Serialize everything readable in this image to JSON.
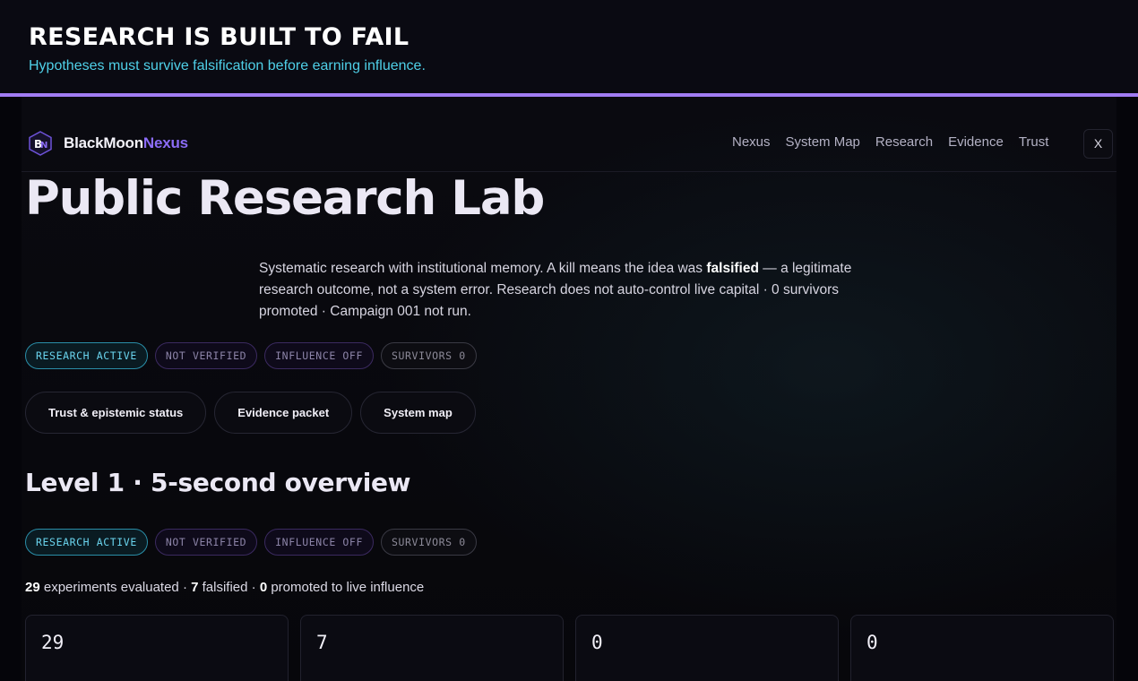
{
  "banner": {
    "title": "RESEARCH IS BUILT TO FAIL",
    "subtitle": "Hypotheses must survive falsification before earning influence."
  },
  "nav": {
    "brand_main": "BlackMoon",
    "brand_accent": "Nexus",
    "links": [
      "Nexus",
      "System Map",
      "Research",
      "Evidence",
      "Trust"
    ],
    "close_label": "X"
  },
  "hero": {
    "title": "Public Research Lab",
    "desc_before": "Systematic research with institutional memory. A kill means the idea was ",
    "desc_bold": "falsified",
    "desc_after": " — a legitimate research outcome, not a system error. Research does not auto-control live capital · 0 survivors promoted · Campaign 001 not run."
  },
  "badges": [
    "RESEARCH ACTIVE",
    "NOT VERIFIED",
    "INFLUENCE OFF",
    "SURVIVORS 0"
  ],
  "pills": [
    "Trust & epistemic status",
    "Evidence packet",
    "System map"
  ],
  "level": {
    "title": "Level 1 · 5-second overview"
  },
  "summary": {
    "evaluated": "29",
    "evaluated_label": " experiments evaluated · ",
    "falsified": "7",
    "falsified_label": " falsified · ",
    "promoted": "0",
    "promoted_label": " promoted to live influence"
  },
  "cards": [
    "29",
    "7",
    "0",
    "0"
  ],
  "colors": {
    "accent_purple": "#a17cf3",
    "brand_accent": "#8b6cf6",
    "cyan": "#4fd0e8"
  }
}
